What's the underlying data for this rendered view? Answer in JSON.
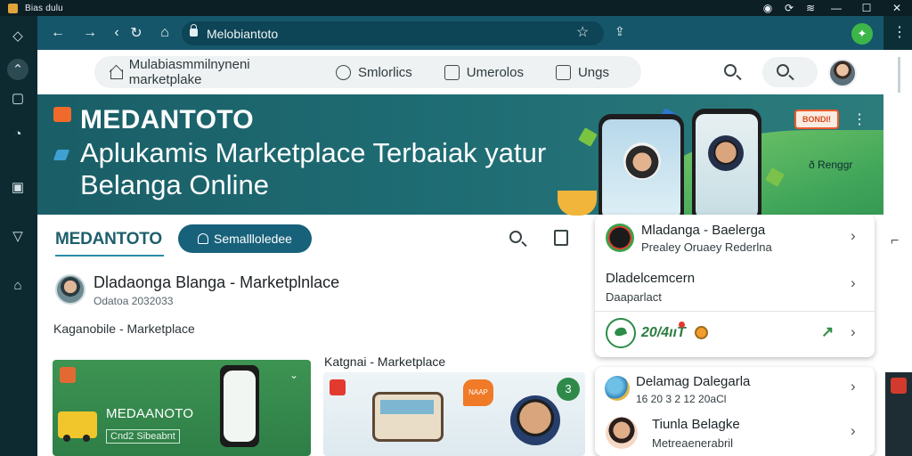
{
  "window": {
    "title": "Bias dulu",
    "controls": [
      "minimize",
      "maximize",
      "close"
    ]
  },
  "browser": {
    "url": "Melobiantoto",
    "nav_icons": [
      "back-icon",
      "forward-icon",
      "loading-icon",
      "refresh-icon",
      "home-icon"
    ],
    "menu_glyph": "⋮"
  },
  "topnav": {
    "items": [
      {
        "label": "Mulabiasmmilnyneni marketplake",
        "icon": "home-icon"
      },
      {
        "label": "Smlorlics",
        "icon": "chat-icon"
      },
      {
        "label": "Umerolos",
        "icon": "square-icon"
      },
      {
        "label": "Ungs",
        "icon": "square-icon"
      }
    ]
  },
  "banner": {
    "brand": "MEDANTOTO",
    "title_line1": "Aplukamis Marketplace Terbaiak yatur",
    "title_line2": "Belanga Online",
    "promo": "BONDI!",
    "side_text": "ð Renggr"
  },
  "store": {
    "logo": "MEDANTOTO",
    "button_label": "Semallloledee"
  },
  "listing": {
    "title": "Dladaonga Blanga - Marketplnlace",
    "subtitle": "Odatoa 2032033",
    "breadcrumb": "Kaganobile - Marketplace",
    "section_label": "Katgnai - Marketplace"
  },
  "cards": {
    "card1_title": "MEDAANOTO",
    "card1_sub": "Cnd2 Sibeabnt",
    "card2_tag": "NAAP",
    "card2_num": "3"
  },
  "right_panel": {
    "row1": {
      "title": "Mladanga - Baelerga",
      "sub": "Prealey Oruaey Rederlna"
    },
    "row2": {
      "title": "Dladelcemcern",
      "sub": "Daaparlact"
    },
    "price": "20/4ııT",
    "row3": {
      "title": "Delamag Dalegarla",
      "sub": "16 20 3 2 12 20aCl"
    },
    "row4": {
      "title": "Tiunla Belagke",
      "sub": "Metreaenerabril"
    }
  },
  "colors": {
    "accent": "#16566a",
    "banner": "#1f6d74",
    "green": "#2c8c48",
    "brand_button": "#17617a"
  }
}
